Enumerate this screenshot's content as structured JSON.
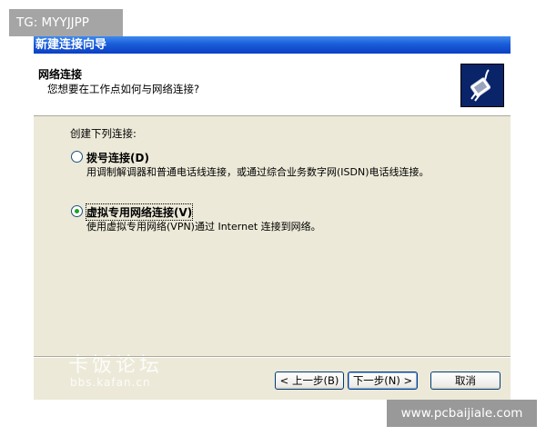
{
  "window": {
    "title": "新建连接向导"
  },
  "header": {
    "title": "网络连接",
    "subtitle": "您想要在工作点如何与网络连接?",
    "icon": "network-plug-icon"
  },
  "body": {
    "section_label": "创建下列连接:",
    "options": [
      {
        "label": "拨号连接(D)",
        "description": "用调制解调器和普通电话线连接，或通过综合业务数字网(ISDN)电话线连接。",
        "selected": false
      },
      {
        "label": "虚拟专用网络连接(V)",
        "description": "使用虚拟专用网络(VPN)通过 Internet 连接到网络。",
        "selected": true
      }
    ]
  },
  "buttons": {
    "back": "< 上一步(B)",
    "next": "下一步(N) >",
    "cancel": "取消"
  },
  "watermark": {
    "text": "卡饭论坛",
    "url": "bbs.kafan.cn"
  },
  "overlays": {
    "top_tag": "TG: MYYJJPP",
    "bottom_tag": "www.pcbaijiale.com"
  },
  "colors": {
    "titlebar": "#0a3fc4",
    "dialog_bg": "#ece9d8",
    "header_bg": "#ffffff",
    "radio_dot": "#21a121"
  }
}
